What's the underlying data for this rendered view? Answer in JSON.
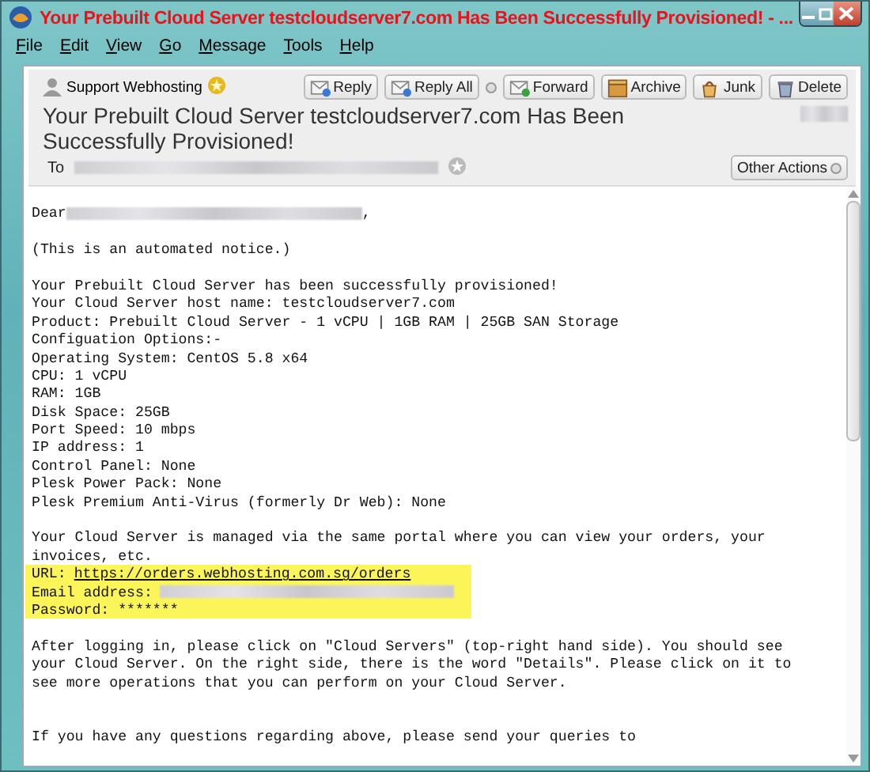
{
  "window": {
    "title": "Your Prebuilt Cloud Server testcloudserver7.com Has Been Successfully Provisioned! - ..."
  },
  "menu": [
    "File",
    "Edit",
    "View",
    "Go",
    "Message",
    "Tools",
    "Help"
  ],
  "header": {
    "sender": "Support Webhosting",
    "sender_starred": true,
    "buttons": [
      {
        "label": "Reply",
        "kind": "reply",
        "dropdown": false
      },
      {
        "label": "Reply All",
        "kind": "reply",
        "dropdown": true
      },
      {
        "label": "Forward",
        "kind": "forward",
        "dropdown": false
      },
      {
        "label": "Archive",
        "kind": "archive",
        "dropdown": false
      },
      {
        "label": "Junk",
        "kind": "junk",
        "dropdown": false
      },
      {
        "label": "Delete",
        "kind": "delete",
        "dropdown": false
      }
    ],
    "subject": "Your Prebuilt Cloud Server testcloudserver7.com Has Been Successfully Provisioned!",
    "to_label": "To",
    "recipient_starred": false,
    "other_actions": "Other Actions"
  },
  "body": [
    {
      "kind": "blank"
    },
    {
      "kind": "greeting",
      "text": "Dear",
      "suffix": ","
    },
    {
      "kind": "blank"
    },
    {
      "kind": "text",
      "text": "(This is an automated notice.)"
    },
    {
      "kind": "blank"
    },
    {
      "kind": "text",
      "text": "Your Prebuilt Cloud Server has been successfully provisioned!"
    },
    {
      "kind": "text",
      "text": "Your Cloud Server host name: testcloudserver7.com"
    },
    {
      "kind": "text",
      "text": "Product: Prebuilt Cloud Server - 1 vCPU | 1GB RAM | 25GB SAN Storage"
    },
    {
      "kind": "text",
      "text": "Configuation Options:-"
    },
    {
      "kind": "text",
      "text": "Operating System: CentOS 5.8 x64"
    },
    {
      "kind": "text",
      "text": "CPU: 1 vCPU"
    },
    {
      "kind": "text",
      "text": "RAM: 1GB"
    },
    {
      "kind": "text",
      "text": "Disk Space: 25GB"
    },
    {
      "kind": "text",
      "text": "Port Speed: 10 mbps"
    },
    {
      "kind": "text",
      "text": "IP address: 1"
    },
    {
      "kind": "text",
      "text": "Control Panel: None"
    },
    {
      "kind": "text",
      "text": "Plesk Power Pack: None"
    },
    {
      "kind": "text",
      "text": "Plesk Premium Anti-Virus (formerly Dr Web): None"
    },
    {
      "kind": "blank"
    },
    {
      "kind": "text",
      "text": "Your Cloud Server is managed via the same portal where you can view your orders, your"
    },
    {
      "kind": "text",
      "text": "invoices, etc."
    },
    {
      "kind": "link",
      "label": "URL:",
      "text": "https://orders.webhosting.com.sg/orders",
      "highlighted": true
    },
    {
      "kind": "redacted",
      "label": "Email address:",
      "highlighted": true
    },
    {
      "kind": "text",
      "text": "Password: *******",
      "highlighted": true
    },
    {
      "kind": "blank"
    },
    {
      "kind": "text",
      "text": "After logging in, please click on \"Cloud Servers\" (top-right hand side). You should see"
    },
    {
      "kind": "text",
      "text": "your Cloud Server. On the right side, there is the word \"Details\". Please click on it to"
    },
    {
      "kind": "text",
      "text": "see more operations that you can perform on your Cloud Server."
    },
    {
      "kind": "blank"
    },
    {
      "kind": "blank"
    },
    {
      "kind": "text",
      "text": "If you have any questions regarding above, please send your queries to"
    }
  ]
}
